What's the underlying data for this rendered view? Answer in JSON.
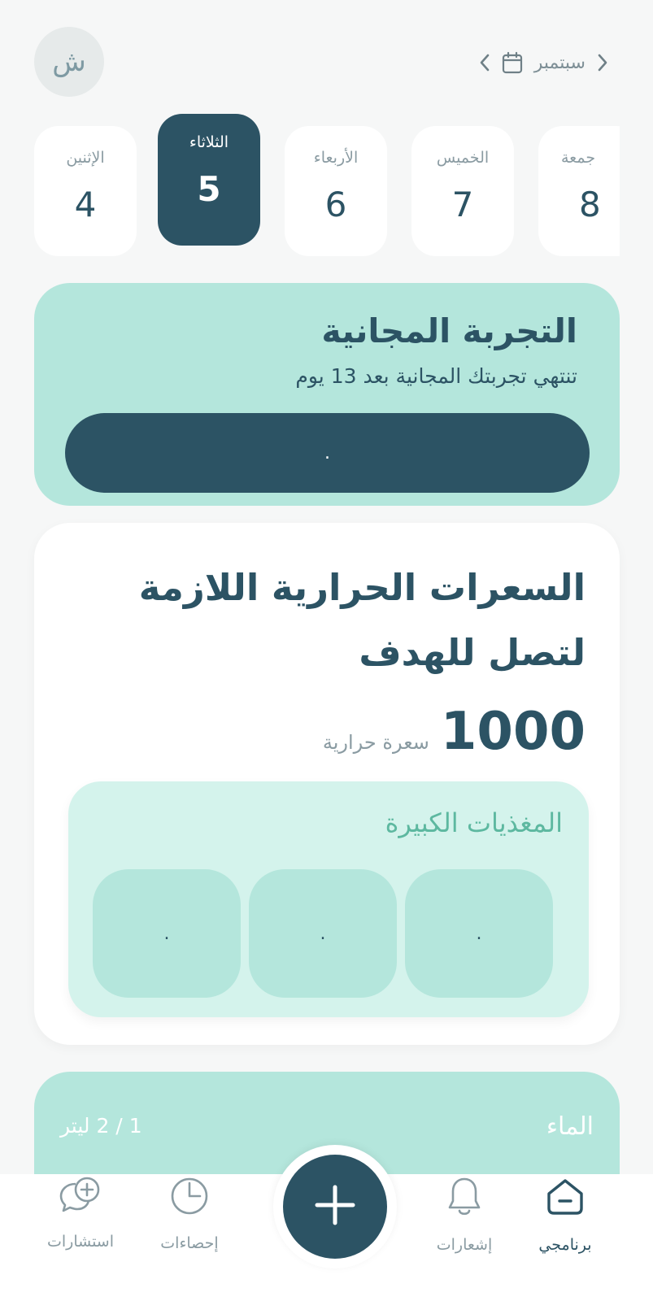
{
  "header": {
    "avatar_initial": "ش",
    "month": "سبتمبر"
  },
  "days": [
    {
      "name": "الإثنين",
      "number": "4",
      "active": false
    },
    {
      "name": "الثلاثاء",
      "number": "5",
      "active": true
    },
    {
      "name": "الأربعاء",
      "number": "6",
      "active": false
    },
    {
      "name": "الخميس",
      "number": "7",
      "active": false
    },
    {
      "name": "جمعة",
      "number": "8",
      "active": false
    }
  ],
  "trial": {
    "title": "التجربة المجانية",
    "subtitle": "تنتهي تجربتك المجانية بعد 13 يوم",
    "button_label": "."
  },
  "calories": {
    "title": "السعرات الحرارية اللازمة لتصل للهدف",
    "value": "1000",
    "unit": "سعرة حرارية",
    "macros": {
      "title": "المغذيات الكبيرة",
      "cells": [
        ".",
        ".",
        "."
      ]
    }
  },
  "water": {
    "title": "الماء",
    "amount": "1 / 2 ليتر"
  },
  "nav": {
    "consultations": "استشارات",
    "stats": "إحصاءات",
    "notifications": "إشعارات",
    "my_program": "برنامجي"
  },
  "colors": {
    "primary": "#2c5364",
    "mint": "#b4e6dc",
    "mint_light": "#d4f3ec",
    "accent_text": "#5db8a0",
    "background": "#f6f7f7"
  }
}
